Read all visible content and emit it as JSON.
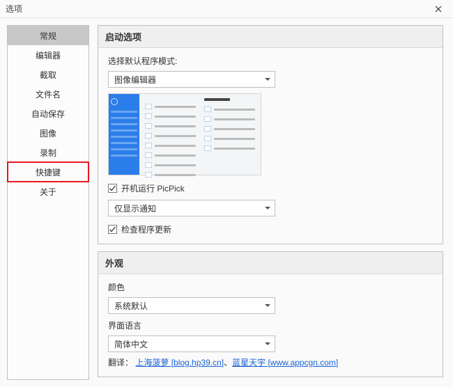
{
  "window": {
    "title": "选项"
  },
  "sidebar": {
    "items": [
      {
        "label": "常规"
      },
      {
        "label": "编辑器"
      },
      {
        "label": "截取"
      },
      {
        "label": "文件名"
      },
      {
        "label": "自动保存"
      },
      {
        "label": "图像"
      },
      {
        "label": "录制"
      },
      {
        "label": "快捷键"
      },
      {
        "label": "关于"
      }
    ]
  },
  "startup": {
    "panel_title": "启动选项",
    "mode_label": "选择默认程序模式:",
    "mode_value": "图像编辑器",
    "run_on_startup_label": "开机运行 PicPick",
    "notify_value": "仅显示通知",
    "check_updates_label": "检查程序更新"
  },
  "appearance": {
    "panel_title": "外观",
    "color_label": "颜色",
    "color_value": "系统默认",
    "lang_label": "界面语言",
    "lang_value": "简体中文",
    "translate_prefix": "翻译：",
    "link1": "上海菠萝 [blog.hp39.cn]",
    "separator": "、",
    "link2": "蓝星天宇 [www.appcgn.com]"
  }
}
